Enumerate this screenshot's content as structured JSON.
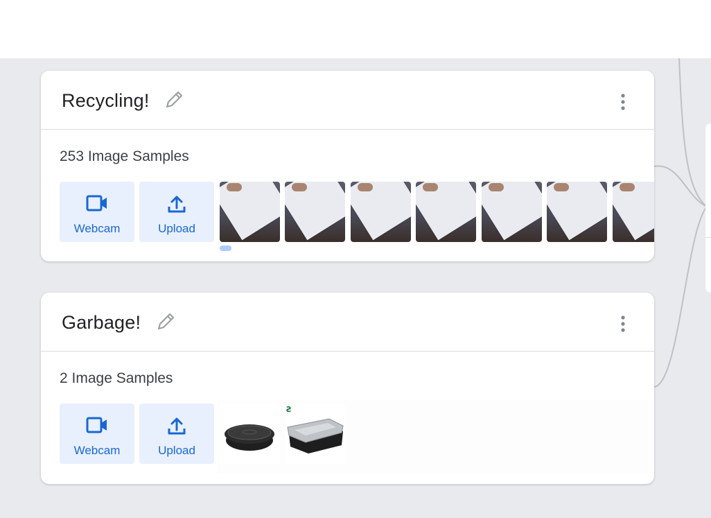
{
  "classes": [
    {
      "title": "Recycling!",
      "samples_label": "253 Image Samples",
      "webcam_label": "Webcam",
      "upload_label": "Upload"
    },
    {
      "title": "Garbage!",
      "samples_label": "2 Image Samples",
      "webcam_label": "Webcam",
      "upload_label": "Upload"
    }
  ],
  "icons": {
    "edit": "pencil-icon",
    "menu": "more-vert-icon",
    "webcam": "videocam-icon",
    "upload": "upload-icon"
  },
  "colors": {
    "accent": "#1967d2",
    "button_bg": "#e8f0fe",
    "background": "#e8eaed"
  }
}
